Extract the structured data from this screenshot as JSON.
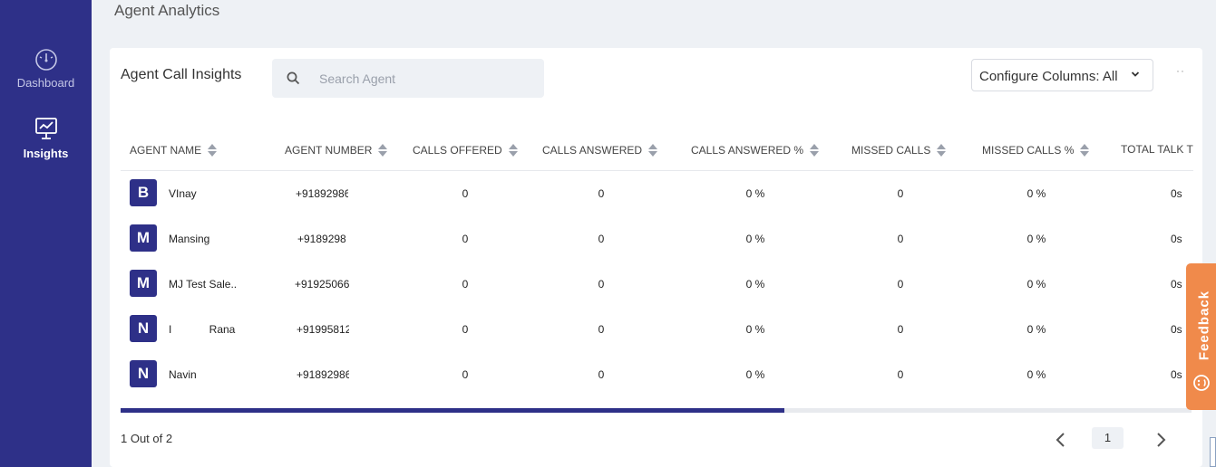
{
  "sidebar": {
    "items": [
      {
        "label": "Dashboard",
        "icon": "speedometer-icon",
        "active": false
      },
      {
        "label": "Insights",
        "icon": "chart-monitor-icon",
        "active": true
      }
    ]
  },
  "page": {
    "title": "Agent Analytics"
  },
  "card": {
    "title": "Agent Call Insights",
    "search": {
      "placeholder": "Search Agent",
      "value": ""
    },
    "configure_label": "Configure Columns: All"
  },
  "table": {
    "columns": [
      "AGENT NAME",
      "AGENT NUMBER",
      "CALLS OFFERED",
      "CALLS ANSWERED",
      "CALLS ANSWERED %",
      "MISSED CALLS",
      "MISSED CALLS %",
      "TOTAL TALK T"
    ],
    "rows": [
      {
        "initial": "B",
        "name": "VInay",
        "number": "+91892986",
        "offered": "0",
        "answered": "0",
        "answered_pct": "0 %",
        "missed": "0",
        "missed_pct": "0 %",
        "talk": "0s"
      },
      {
        "initial": "M",
        "name": "Mansing",
        "number": "+9189298",
        "offered": "0",
        "answered": "0",
        "answered_pct": "0 %",
        "missed": "0",
        "missed_pct": "0 %",
        "talk": "0s"
      },
      {
        "initial": "M",
        "name": "MJ Test Sale..",
        "number": "+91925066",
        "offered": "0",
        "answered": "0",
        "answered_pct": "0 %",
        "missed": "0",
        "missed_pct": "0 %",
        "talk": "0s"
      },
      {
        "initial": "N",
        "name": "I Rana",
        "number": "+91995812",
        "offered": "0",
        "answered": "0",
        "answered_pct": "0 %",
        "missed": "0",
        "missed_pct": "0 %",
        "talk": "0s"
      },
      {
        "initial": "N",
        "name": "Navin",
        "number": "+91892986",
        "offered": "0",
        "answered": "0",
        "answered_pct": "0 %",
        "missed": "0",
        "missed_pct": "0 %",
        "talk": "0s"
      }
    ],
    "horizontal_scroll_position": 0.62
  },
  "pagination": {
    "info": "1 Out of 2",
    "current_page": "1"
  },
  "feedback": {
    "label": "Feedback"
  },
  "colors": {
    "sidebar": "#2e3088",
    "accent": "#2e3088",
    "feedback": "#f08a4b",
    "background": "#eef1f5"
  }
}
